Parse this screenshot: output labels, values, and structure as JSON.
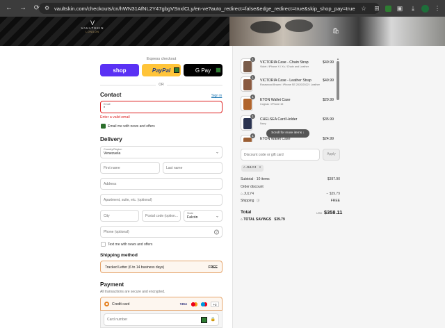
{
  "browser": {
    "url": "vaultskin.com/checkouts/cn/hWN31AfNL2Y47gbgVSnxlCLy/en-ve?auto_redirect=false&edge_redirect=true&skip_shop_pay=true",
    "colors": {
      "chrome": "#3c3c3c",
      "urlbar": "#282828"
    }
  },
  "header": {
    "brand": "VAULTSKIN",
    "brand_sub": "LONDON",
    "logo_mark": "V"
  },
  "express": {
    "title": "Express checkout",
    "shop_label": "shop",
    "paypal_label": "PayPal",
    "gpay_label": "G Pay",
    "or_label": "OR",
    "colors": {
      "shop": "#5a31f4",
      "paypal": "#ffc439",
      "gpay": "#000000"
    }
  },
  "contact": {
    "heading": "Contact",
    "sign_in": "Sign in",
    "email_label": "Email",
    "email_value": "*",
    "error": "Enter a valid email",
    "newsletter_label": "Email me with news and offers",
    "newsletter_checked": true
  },
  "delivery": {
    "heading": "Delivery",
    "country_label": "Country/Region",
    "country_value": "Venezuela",
    "first_name_ph": "First name",
    "last_name_ph": "Last name",
    "address_ph": "Address",
    "apartment_ph": "Apartment, suite, etc. (optional)",
    "city_ph": "City",
    "postal_ph": "Postal code (option...",
    "state_label": "State",
    "state_value": "Falcón",
    "phone_ph": "Phone (optional)",
    "sms_label": "Text me with news and offers"
  },
  "shipping": {
    "heading": "Shipping method",
    "option_name": "Tracked Letter (6 to 14 business days)",
    "option_price": "FREE"
  },
  "payment": {
    "heading": "Payment",
    "subtitle": "All transactions are secure and encrypted.",
    "method": "Credit card",
    "card_brands": [
      "VISA",
      "MC",
      "MAESTRO",
      "+3"
    ],
    "card_number_ph": "Card number"
  },
  "cart": {
    "items": [
      {
        "qty": "1",
        "name": "VICTORIA Case - Chain Strap",
        "variant": "Violet / iPhone X / Xs / Chain and Leather",
        "price": "$49.99",
        "color": "#7a5c4a"
      },
      {
        "qty": "1",
        "name": "VICTORIA Case - Leather Strap",
        "variant": "Rosewood Brown / iPhone SE 2020/2022 / Leather",
        "price": "$49.99",
        "color": "#8a5a40"
      },
      {
        "qty": "1",
        "name": "ETON Wallet Case",
        "variant": "Cognac / iPhone 15",
        "price": "$29.99",
        "color": "#b0642c"
      },
      {
        "qty": "1",
        "name": "CHELSEA Card Holder",
        "variant": "Navy",
        "price": "$35.99",
        "color": "#2a3350"
      },
      {
        "qty": "1",
        "name": "ETON Wallet Case",
        "variant": "",
        "price": "$24.99",
        "color": "#9b5e33"
      }
    ],
    "scroll_hint": "Scroll for more items",
    "discount_ph": "Discount code or gift card",
    "apply_label": "Apply",
    "applied_code": "JULY4",
    "subtotal_label": "Subtotal · 10 items",
    "subtotal_value": "$397.90",
    "order_discount_label": "Order discount",
    "order_discount_code": "JULY4",
    "order_discount_value": "− $39.79",
    "shipping_label": "Shipping",
    "shipping_value": "FREE",
    "total_label": "Total",
    "total_currency": "USD",
    "total_value": "$358.11",
    "savings_label": "TOTAL SAVINGS",
    "savings_value": "$39.79"
  }
}
